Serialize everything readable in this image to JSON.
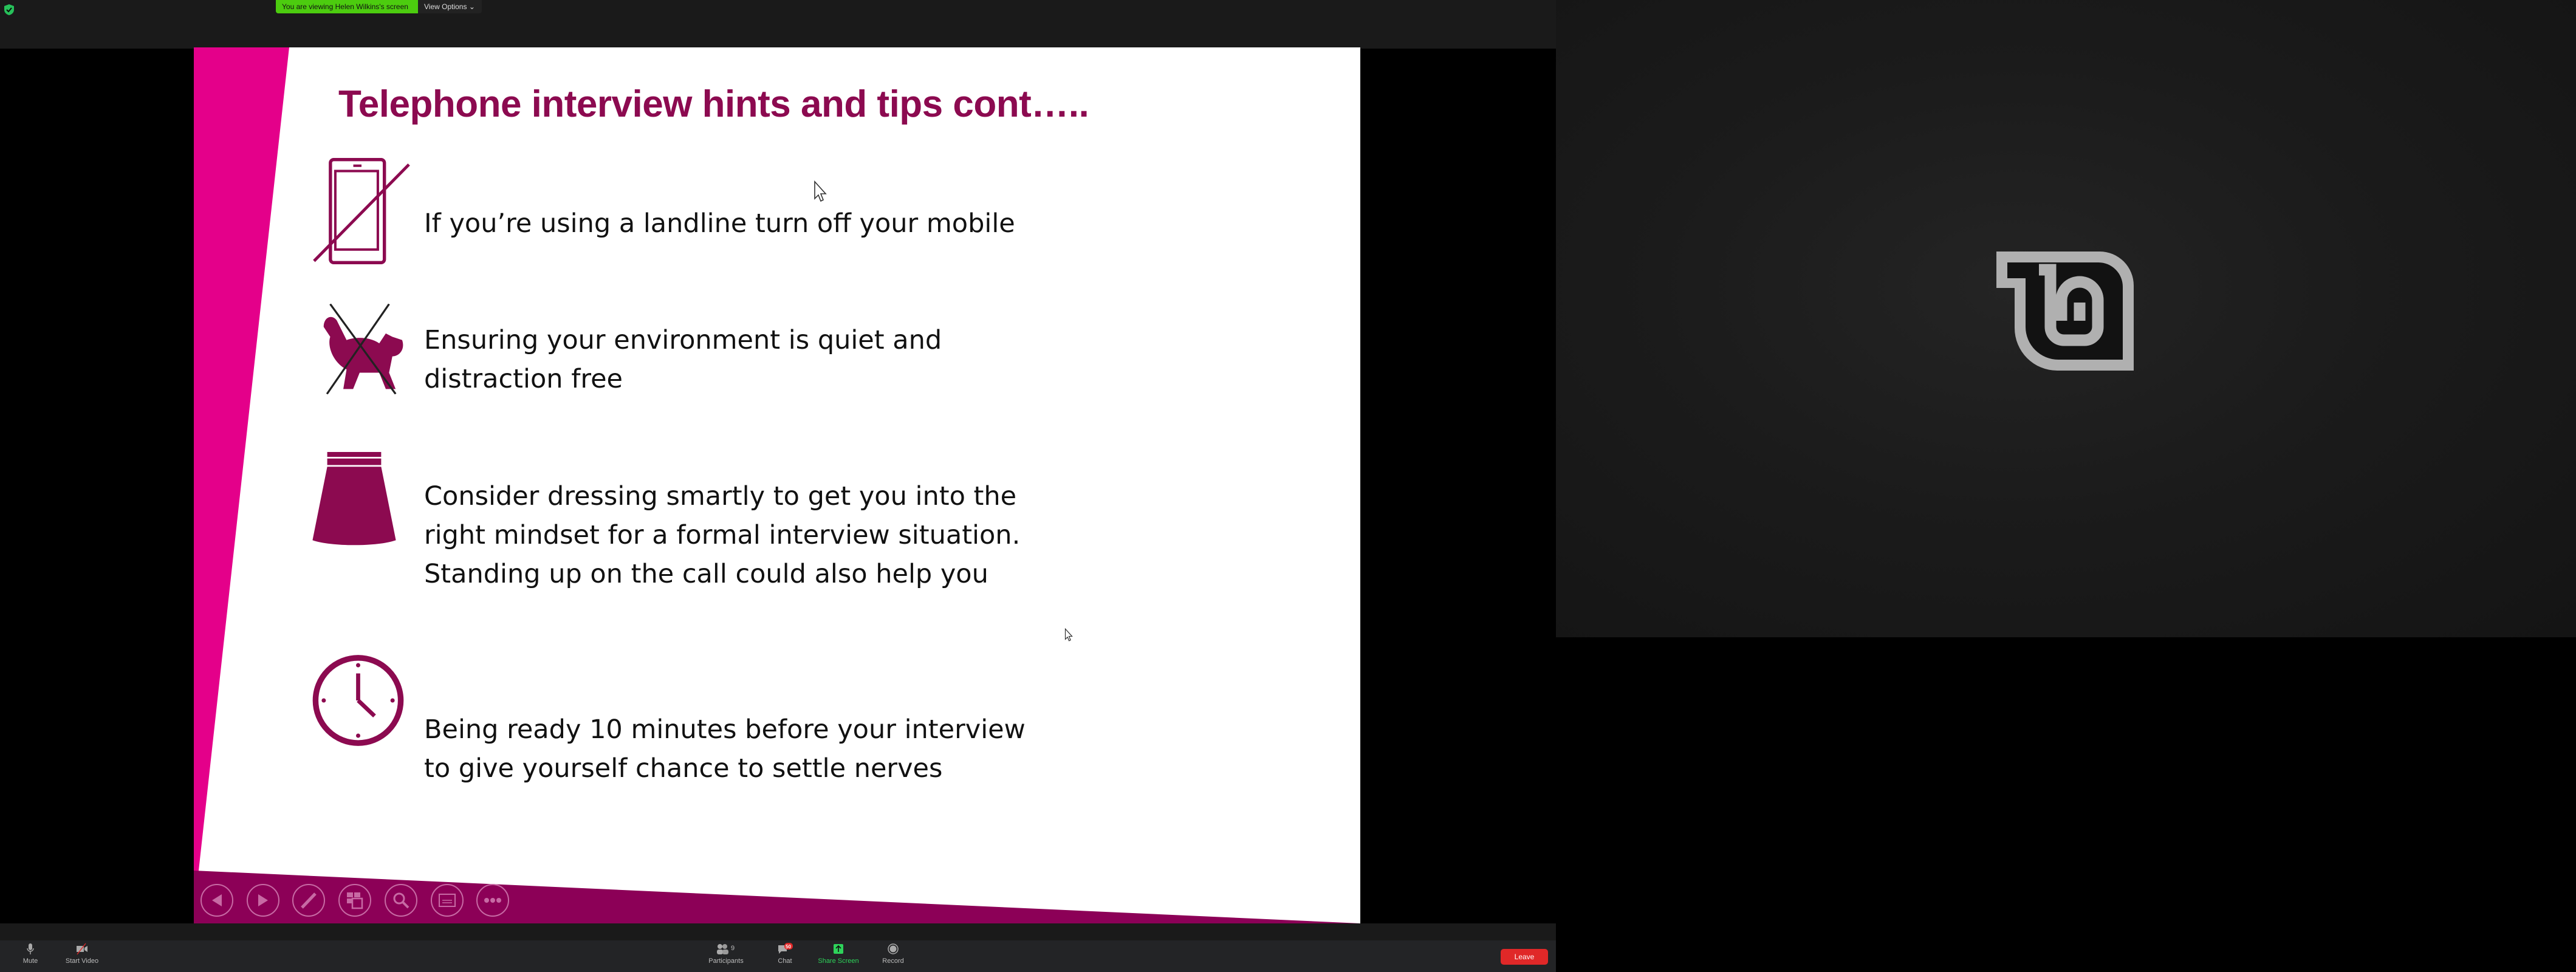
{
  "meeting": {
    "banner": "You are viewing Helen Wilkins's screen",
    "view_options": "View Options",
    "icons": {
      "security": "shield-check-icon",
      "logo": "linux-mint-logo"
    }
  },
  "slide": {
    "title": "Telephone interview hints and tips cont…..",
    "tips": [
      {
        "icon": "no-mobile-phone-icon",
        "text": "If you’re using a landline turn off your mobile"
      },
      {
        "icon": "no-pets-icon",
        "text": "Ensuring your environment is quiet and\ndistraction free"
      },
      {
        "icon": "skirt-icon",
        "text": "Consider dressing smartly to get you into the\nright mindset for a formal interview situation.\nStanding up on the call could also help you"
      },
      {
        "icon": "clock-icon",
        "text": "Being ready 10 minutes before your interview\nto give yourself chance to settle nerves"
      }
    ],
    "colors": {
      "accent_pink": "#e4008a",
      "accent_plum": "#8c0a50"
    },
    "controls": [
      "previous",
      "next",
      "pen",
      "see-all-slides",
      "zoom",
      "subtitles",
      "more-options"
    ]
  },
  "toolbar": {
    "mute": "Mute",
    "start_video": "Start Video",
    "participants": "Participants",
    "participants_count": "9",
    "chat": "Chat",
    "chat_badge": "50",
    "share_screen": "Share Screen",
    "record": "Record",
    "leave": "Leave"
  }
}
